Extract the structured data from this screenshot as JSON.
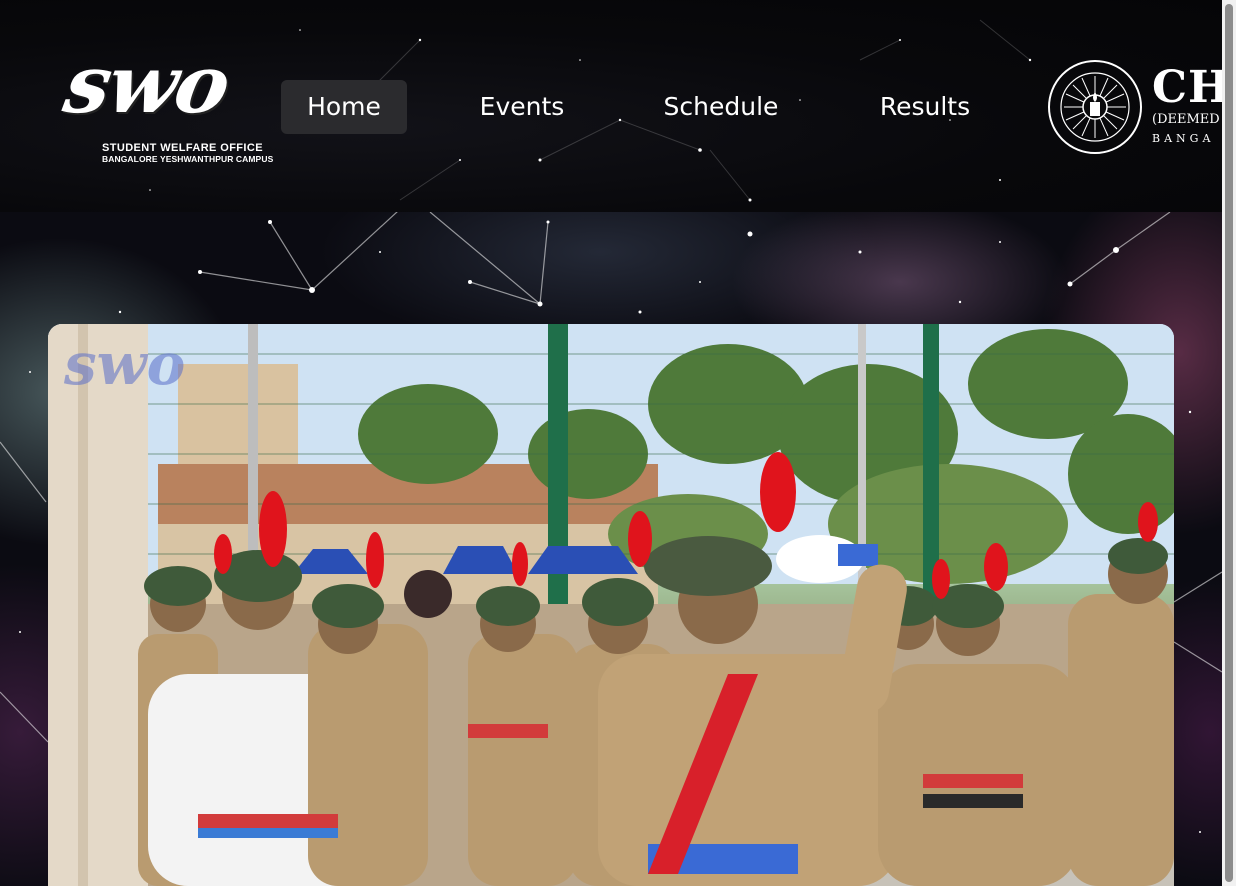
{
  "header": {
    "logo": {
      "mark": "swo",
      "line1": "STUDENT WELFARE OFFICE",
      "line2": "BANGALORE YESHWANTHPUR CAMPUS"
    },
    "nav": [
      {
        "label": "Home",
        "active": true
      },
      {
        "label": "Events",
        "active": false
      },
      {
        "label": "Schedule",
        "active": false
      },
      {
        "label": "Results",
        "active": false
      }
    ],
    "university": {
      "title": "CH",
      "line2": "(DEEMED T",
      "line3": "BANGA"
    }
  },
  "hero": {
    "watermark": "swo",
    "image_icon": "parade-photo"
  },
  "colors": {
    "header_bg": "#08080b",
    "nav_active_bg": "#2b2b2e",
    "text": "#ffffff",
    "scrollbar_thumb": "#8c8c8c"
  }
}
